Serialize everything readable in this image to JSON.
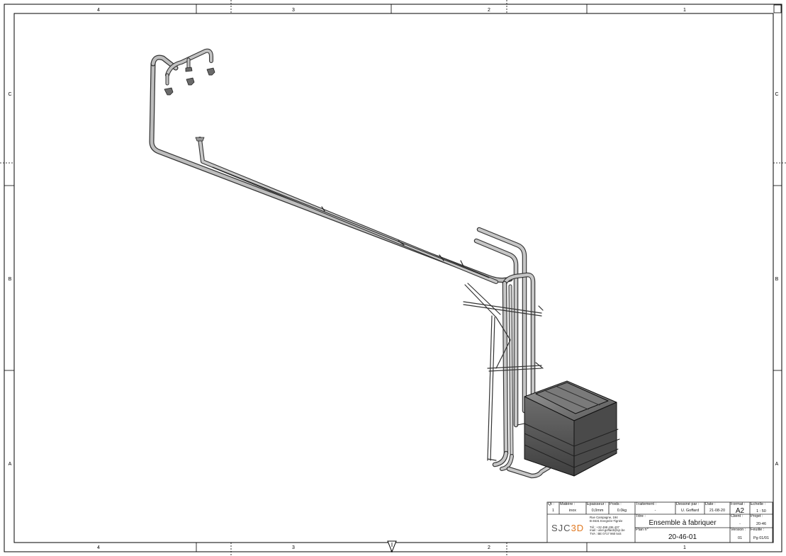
{
  "border": {
    "top_numbers": [
      "4",
      "3",
      "2",
      "1"
    ],
    "bottom_numbers": [
      "4",
      "3",
      "2",
      "1"
    ],
    "left_letters": [
      "C",
      "B",
      "A"
    ],
    "right_letters": [
      "C",
      "B",
      "A"
    ]
  },
  "title_block": {
    "qty_label": "Qt :",
    "qty_value": "1",
    "material_label": "Matière :",
    "material_value": "inox",
    "thickness_label": "Epaisseur :",
    "thickness_value": "0,0mm",
    "weight_label": "Poids :",
    "weight_value": "0.0kg",
    "treatment_label": "Traitement :",
    "treatment_value": "-",
    "drawn_by_label": "Dessiné par :",
    "drawn_by_value": "U. Goffard",
    "date_label": "Date :",
    "date_value": "21-08-20",
    "format_label": "Format :",
    "format_value": "A2",
    "scale_label": "Echelle :",
    "scale_value": "1 : 50",
    "title_label": "Titre :",
    "title_value": "Ensemble à fabriquer",
    "client_label": "Client :",
    "client_value": "-",
    "project_label": "Projet :",
    "project_value": "20-46",
    "plan_label": "Plan n°",
    "plan_value": "20-46-01",
    "version_label": "Version :",
    "version_value": "01",
    "sheet_label": "Feuille :",
    "sheet_value": "Pg 01/01",
    "logo_prefix": "SJC",
    "logo_suffix": "3D",
    "address": [
      "Rue Campagne, 194",
      "B-4631 Evegnée-Tignée",
      "",
      "Tél : +32 498 436 437",
      "mail : uriel.goffard@sjc.be",
      "TVA : BE 0717 960 544"
    ]
  },
  "colors": {
    "line": "#000000",
    "steel": "#8c8c8c",
    "steel_dark": "#555555",
    "steel_light": "#c4c4c4"
  }
}
